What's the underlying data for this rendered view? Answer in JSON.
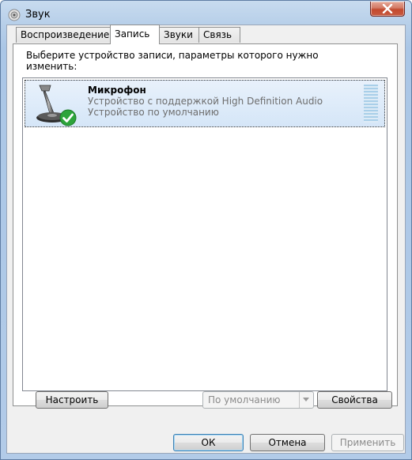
{
  "window": {
    "title": "Звук"
  },
  "tabs": [
    {
      "label": "Воспроизведение"
    },
    {
      "label": "Запись"
    },
    {
      "label": "Звуки"
    },
    {
      "label": "Связь"
    }
  ],
  "recording": {
    "instruction": "Выберите устройство записи, параметры которого нужно изменить:",
    "devices": [
      {
        "name": "Микрофон",
        "description": "Устройство с поддержкой High Definition Audio",
        "status": "Устройство по умолчанию",
        "icon": "microphone-icon",
        "status_icon": "checkmark-icon"
      }
    ]
  },
  "buttons": {
    "configure": "Настроить",
    "set_default": "По умолчанию",
    "properties": "Свойства",
    "ok": "ОК",
    "cancel": "Отмена",
    "apply": "Применить"
  },
  "colors": {
    "selection": "#d5e6f8",
    "check_green": "#2da43b",
    "close_red": "#c34a2f"
  }
}
